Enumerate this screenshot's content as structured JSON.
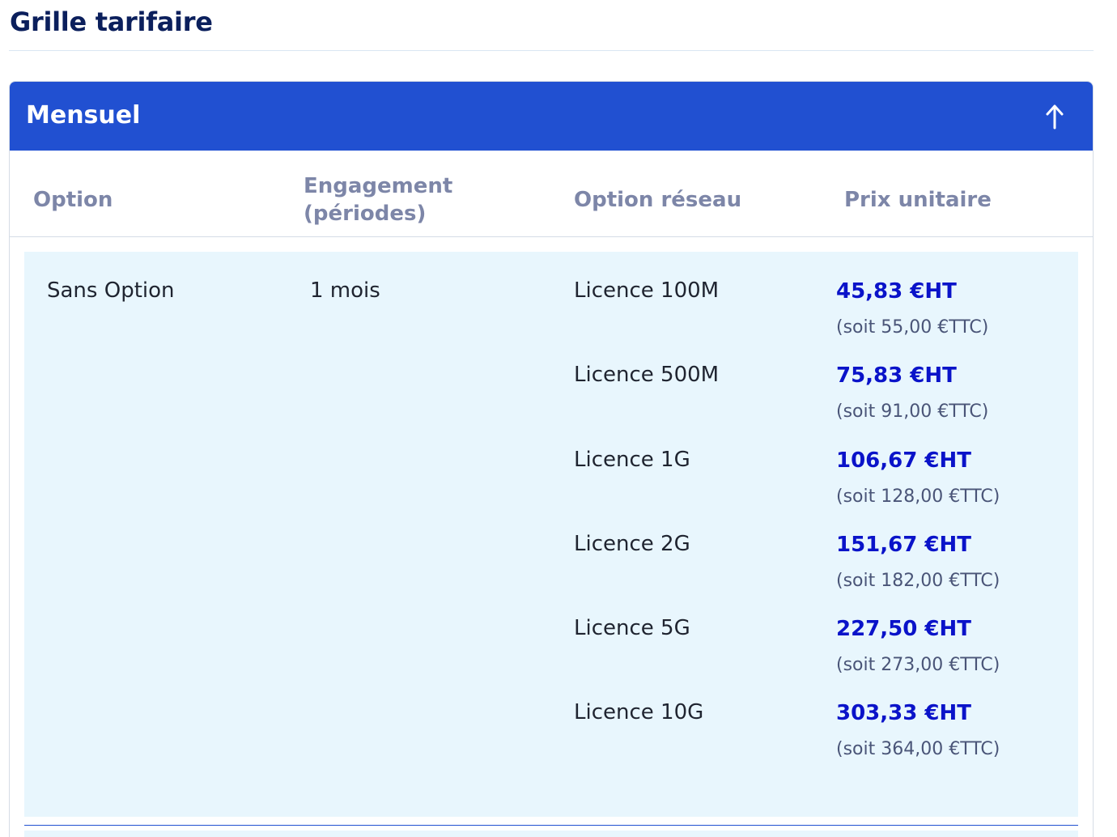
{
  "page": {
    "title": "Grille tarifaire"
  },
  "accordion": {
    "label": "Mensuel",
    "toggle_icon": "arrow-up-icon",
    "colors": {
      "header_bg": "#2150d1",
      "header_text": "#ffffff",
      "row_bg": "#e8f6fd",
      "price_ht": "#0a13c9"
    }
  },
  "table": {
    "headers": {
      "option": "Option",
      "engagement": "Engagement (périodes)",
      "network": "Option réseau",
      "unit_price": "Prix unitaire"
    },
    "group": {
      "option": "Sans Option",
      "engagement": "1 mois",
      "rows": [
        {
          "network": "Licence 100M",
          "price_ht": "45,83 €HT",
          "price_ttc": "(soit 55,00 €TTC)"
        },
        {
          "network": "Licence 500M",
          "price_ht": "75,83 €HT",
          "price_ttc": "(soit 91,00 €TTC)"
        },
        {
          "network": "Licence 1G",
          "price_ht": "106,67 €HT",
          "price_ttc": "(soit 128,00 €TTC)"
        },
        {
          "network": "Licence 2G",
          "price_ht": "151,67 €HT",
          "price_ttc": "(soit 182,00 €TTC)"
        },
        {
          "network": "Licence 5G",
          "price_ht": "227,50 €HT",
          "price_ttc": "(soit 273,00 €TTC)"
        },
        {
          "network": "Licence 10G",
          "price_ht": "303,33 €HT",
          "price_ttc": "(soit 364,00 €TTC)"
        }
      ]
    }
  }
}
